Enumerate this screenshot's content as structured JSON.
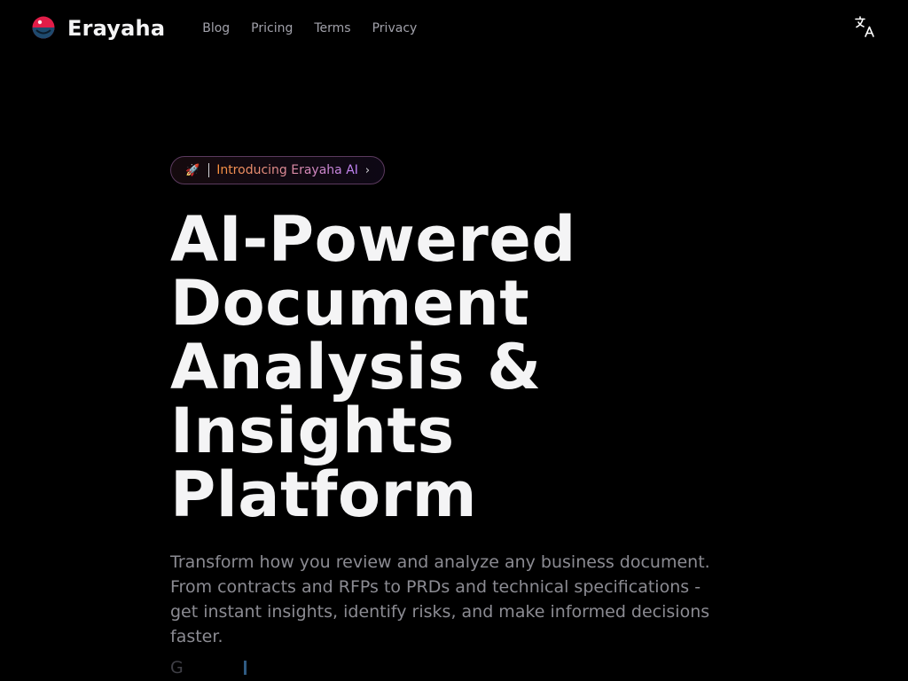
{
  "header": {
    "brand_name": "Erayaha",
    "nav": [
      {
        "label": "Blog"
      },
      {
        "label": "Pricing"
      },
      {
        "label": "Terms"
      },
      {
        "label": "Privacy"
      }
    ],
    "language_icon": "translate-icon"
  },
  "hero": {
    "badge": {
      "icon": "rocket-icon",
      "text": "Introducing Erayaha AI",
      "chevron": "›"
    },
    "headline": [
      "AI-Powered",
      "Document",
      "Analysis &",
      "Insights",
      "Platform"
    ],
    "subtext": "Transform how you review and analyze any business document. From contracts and RFPs to PRDs and technical specifications - get instant insights, identify risks, and make informed decisions faster.",
    "typing_text": "G"
  },
  "colors": {
    "background": "#000000",
    "logo_top": "#e11d48",
    "logo_bottom": "#1e4a6e",
    "badge_gradient_start": "#fb923c",
    "badge_gradient_end": "#c084fc",
    "subtext": "#8b8b92"
  }
}
